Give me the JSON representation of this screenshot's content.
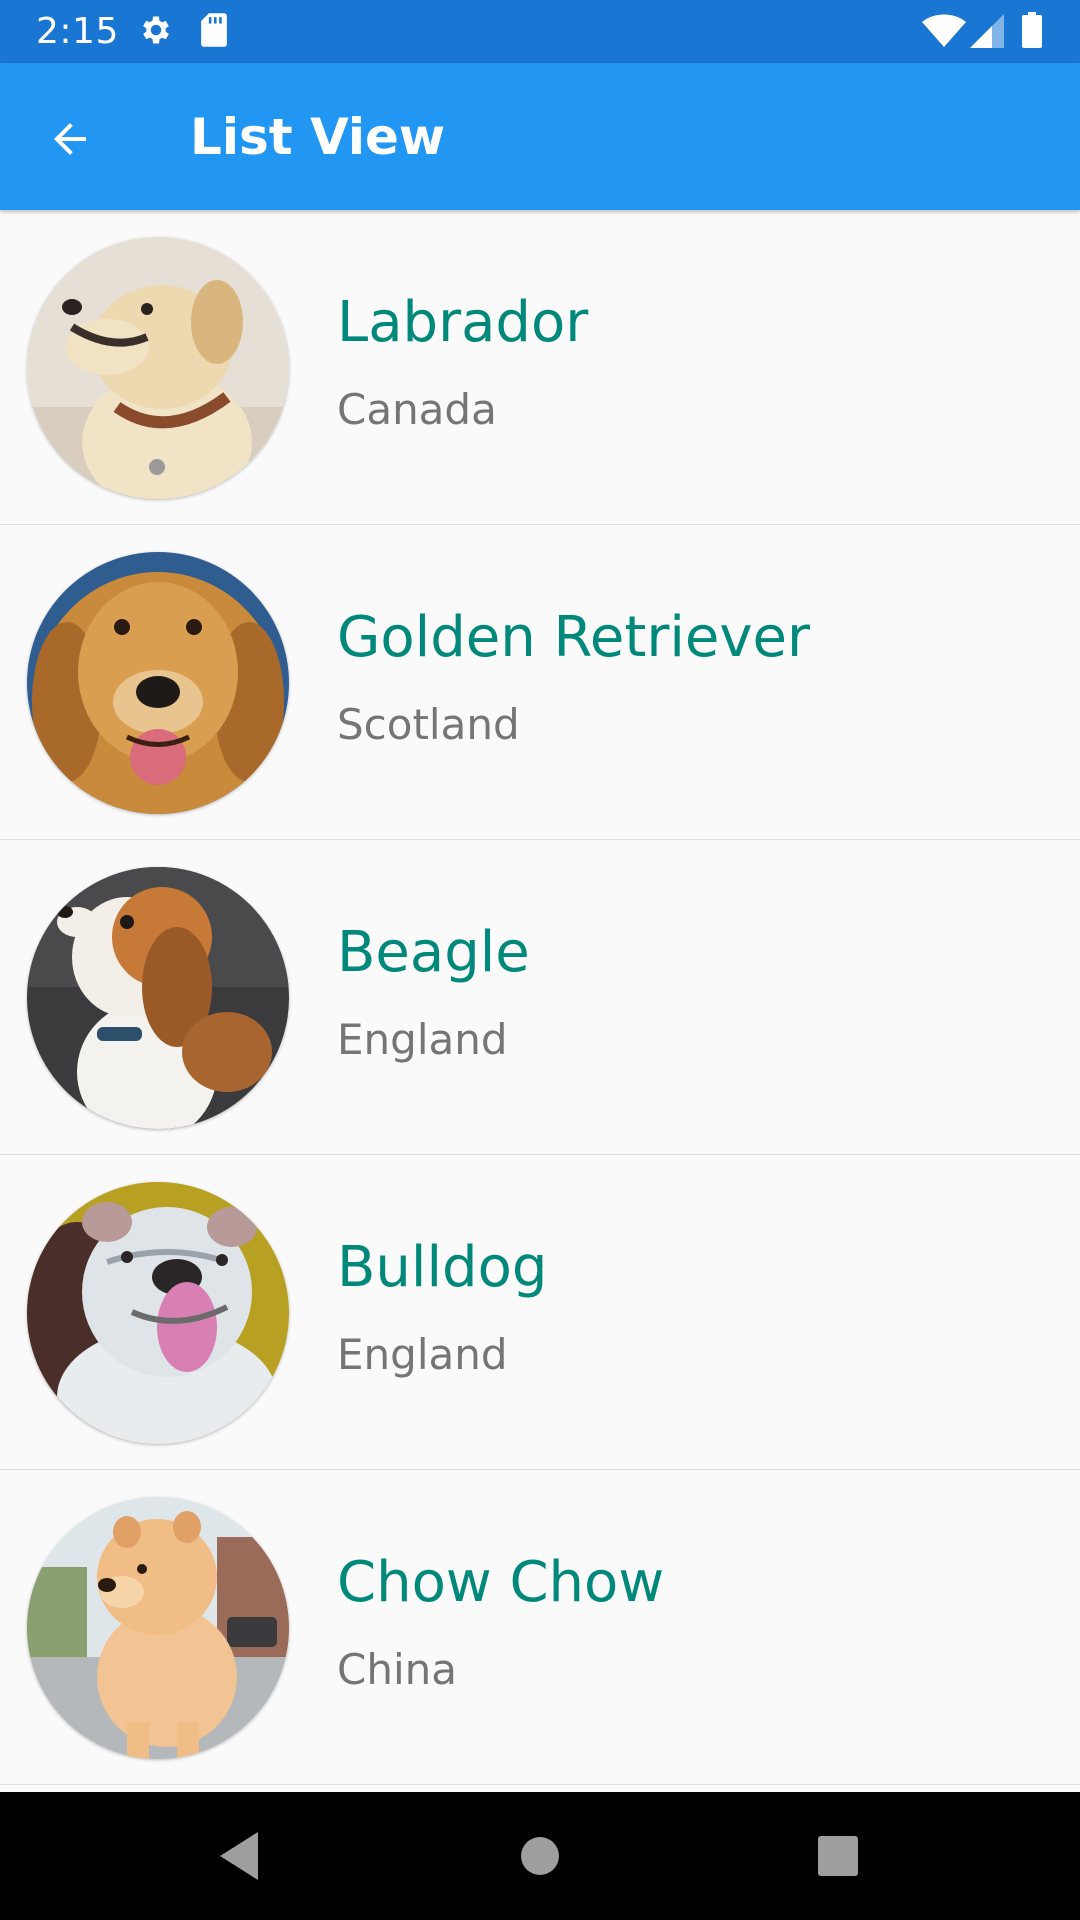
{
  "status_bar": {
    "time": "2:15",
    "icons": [
      "gear-icon",
      "sd-card-icon",
      "wifi-icon",
      "signal-icon",
      "battery-icon"
    ]
  },
  "app_bar": {
    "title": "List View",
    "back_icon": "arrow-back-icon",
    "color": "#2196f3"
  },
  "list": {
    "title_color": "#00897b",
    "subtitle_color": "#757575",
    "items": [
      {
        "name": "Labrador",
        "origin": "Canada"
      },
      {
        "name": "Golden Retriever",
        "origin": "Scotland"
      },
      {
        "name": "Beagle",
        "origin": "England"
      },
      {
        "name": "Bulldog",
        "origin": "England"
      },
      {
        "name": "Chow Chow",
        "origin": "China"
      }
    ]
  },
  "nav_bar": {
    "icons": [
      "back-triangle-icon",
      "home-circle-icon",
      "recents-square-icon"
    ]
  }
}
